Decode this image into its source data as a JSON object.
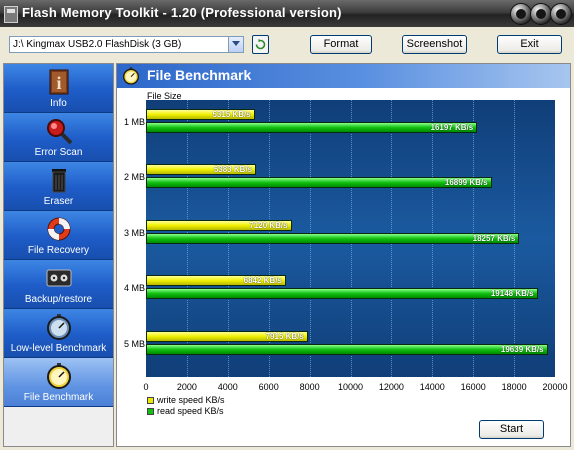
{
  "window": {
    "title": "Flash Memory Toolkit - 1.20 (Professional version)"
  },
  "toolbar": {
    "drive": "J:\\ Kingmax USB2.0 FlashDisk (3 GB)",
    "format_label": "Format",
    "screenshot_label": "Screenshot",
    "exit_label": "Exit"
  },
  "sidebar": {
    "items": [
      {
        "label": "Info",
        "icon": "info-icon"
      },
      {
        "label": "Error Scan",
        "icon": "magnifier-icon"
      },
      {
        "label": "Eraser",
        "icon": "trash-can-icon"
      },
      {
        "label": "File Recovery",
        "icon": "life-ring-icon"
      },
      {
        "label": "Backup/restore",
        "icon": "tape-icon"
      },
      {
        "label": "Low-level Benchmark",
        "icon": "stopwatch-icon"
      },
      {
        "label": "File Benchmark",
        "icon": "stopwatch-yellow-icon",
        "active": true
      }
    ]
  },
  "panel": {
    "title": "File Benchmark",
    "start_label": "Start"
  },
  "colors": {
    "write": "#e8e800",
    "read": "#10c010",
    "plot_bg": "#154b8c",
    "accent": "#2c67c9"
  },
  "chart_data": {
    "type": "bar",
    "orientation": "horizontal",
    "title": "File Size",
    "categories": [
      "1 MB",
      "2 MB",
      "3 MB",
      "4 MB",
      "5 MB"
    ],
    "series": [
      {
        "name": "write speed KB/s",
        "values": [
          5315,
          5383,
          7120,
          6842,
          7915
        ],
        "labels": [
          "5315 KB/s",
          "5383 KB/s",
          "7120 KB/s",
          "6842 KB/s",
          "7915 KB/s"
        ]
      },
      {
        "name": "read speed KB/s",
        "values": [
          16197,
          16899,
          18257,
          19148,
          19639
        ],
        "labels": [
          "16197 KB/s",
          "16899 KB/s",
          "18257 KB/s",
          "19148 KB/s",
          "19639 KB/s"
        ]
      }
    ],
    "xlim": [
      0,
      20000
    ],
    "xticks": [
      "0",
      "2000",
      "4000",
      "6000",
      "8000",
      "10000",
      "12000",
      "14000",
      "16000",
      "18000",
      "20000"
    ],
    "grid": true,
    "legend": "bottom-left"
  }
}
